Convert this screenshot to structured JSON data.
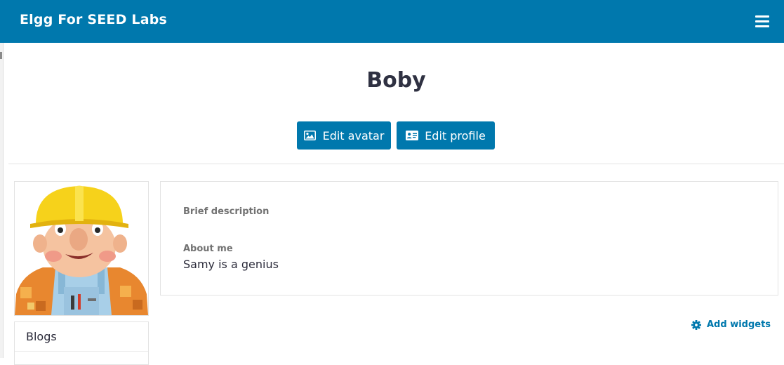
{
  "topbar": {
    "site_name": "Elgg For SEED Labs",
    "menu_icon": "hamburger-icon",
    "color": "#0078ad"
  },
  "profile": {
    "name": "Boby",
    "edit_avatar_label": "Edit avatar",
    "edit_avatar_icon": "image-icon",
    "edit_profile_label": "Edit profile",
    "edit_profile_icon": "id-card-icon"
  },
  "owner_menu": {
    "items": [
      {
        "label": "Blogs"
      }
    ]
  },
  "details": {
    "brief_description_label": "Brief description",
    "about_me_label": "About me",
    "about_me_value": "Samy is a genius"
  },
  "widgets": {
    "add_label": "Add widgets",
    "add_icon": "gear-icon"
  }
}
